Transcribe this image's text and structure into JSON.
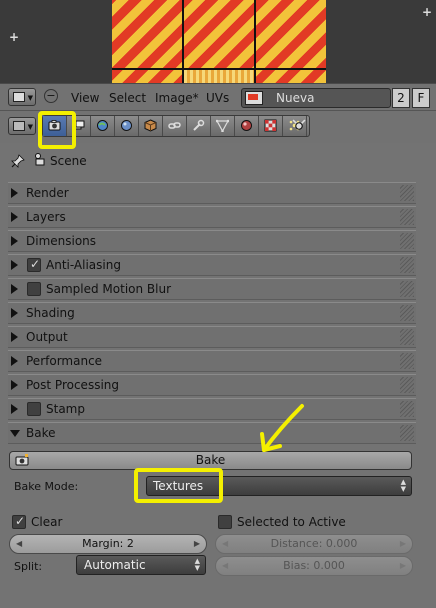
{
  "image_header": {
    "menus": [
      "View",
      "Select",
      "Image*",
      "UVs"
    ],
    "image_name": "Nueva",
    "users_count": "2",
    "fake_user": "F"
  },
  "properties": {
    "tabs": [
      "render-icon",
      "render-layers-icon",
      "world-icon",
      "object-icon",
      "constraints-icon",
      "modifiers-icon",
      "data-icon",
      "material-icon",
      "texture-icon",
      "particles-icon",
      "physics-icon"
    ],
    "active_tab": "render-icon",
    "context": "Scene",
    "panels": [
      {
        "label": "Render",
        "has_checkbox": false
      },
      {
        "label": "Layers",
        "has_checkbox": false
      },
      {
        "label": "Dimensions",
        "has_checkbox": false
      },
      {
        "label": "Anti-Aliasing",
        "has_checkbox": true,
        "checked": true
      },
      {
        "label": "Sampled Motion Blur",
        "has_checkbox": true,
        "checked": false
      },
      {
        "label": "Shading",
        "has_checkbox": false
      },
      {
        "label": "Output",
        "has_checkbox": false
      },
      {
        "label": "Performance",
        "has_checkbox": false
      },
      {
        "label": "Post Processing",
        "has_checkbox": false
      },
      {
        "label": "Stamp",
        "has_checkbox": true,
        "checked": false
      }
    ],
    "bake": {
      "panel_label": "Bake",
      "button_label": "Bake",
      "mode_label": "Bake Mode:",
      "mode_value": "Textures",
      "clear_label": "Clear",
      "clear_checked": true,
      "selected_to_active_label": "Selected to Active",
      "selected_to_active_checked": false,
      "margin": "Margin: 2",
      "distance": "Distance: 0.000",
      "bias": "Bias: 0.000",
      "split_label": "Split:",
      "split_value": "Automatic"
    }
  },
  "colors": {
    "highlight": "#f4f000",
    "stripe_yellow": "#f2c33a",
    "stripe_red": "#e23a25",
    "active_tab": "#4a6ca6"
  }
}
